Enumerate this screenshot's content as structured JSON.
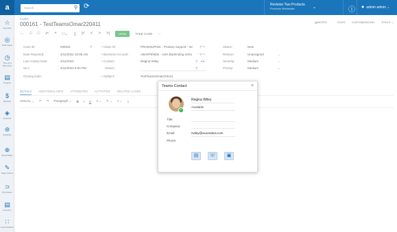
{
  "topbar": {
    "search_placeholder": "Search",
    "tenant_name": "Revision Two Products",
    "tenant_sub": "Products Wholesale",
    "user_name": "admin admin"
  },
  "sidebar": {
    "items": [
      {
        "label": "Favorites",
        "icon": "star-icon"
      },
      {
        "label": "Data Views",
        "icon": "views-icon"
      },
      {
        "label": "Time and Expenses",
        "icon": "clock-icon"
      },
      {
        "label": "Projects",
        "icon": "projects-icon"
      },
      {
        "label": "Banking",
        "icon": "dollar-icon"
      },
      {
        "label": "Products",
        "icon": "products-icon"
      },
      {
        "label": "Payables",
        "icon": "payables-icon"
      },
      {
        "label": "Receivables",
        "icon": "receivables-icon"
      },
      {
        "label": "Sales Orders",
        "icon": "sales-icon"
      },
      {
        "label": "Purchases",
        "icon": "cart-icon"
      },
      {
        "label": "Inventory",
        "icon": "truck-icon"
      },
      {
        "label": "Customization",
        "icon": "custom-icon"
      }
    ]
  },
  "page": {
    "breadcrumb": "Cases",
    "title": "000161 - TestTeamsOmar220411",
    "status_button": "OPEN",
    "take_case": "TAKE CASE",
    "more": "···",
    "right_tools": {
      "notes": "NOTES",
      "files": "FILES",
      "customization": "CUSTOMIZATION",
      "tools": "TOOLS"
    }
  },
  "form": {
    "case_id_label": "Case ID:",
    "case_id": "000161",
    "date_reported_label": "Date Reported:",
    "date_reported": "4/11/2022 10:06 AM",
    "last_activity_label": "Last Activity Date:",
    "last_activity": "4/11/2022",
    "sla_label": "SLA:",
    "sla": "4/11/2022 5:04 PM",
    "closing_label": "Closing Date:",
    "class_id_label": "• Class ID:",
    "class_id": "PRODSUPINC - Product Support - Inc",
    "business_label": "• Business Account:",
    "business": "ABARTENDE - USA Bartending Scho",
    "contact_label": "• Contact:",
    "contact": "Regina Wiley",
    "owner_label": "Owner:",
    "subject_label": "• Subject:",
    "subject": "TestTeamsOmar220411",
    "status_label": "Status:",
    "status": "New",
    "reason_label": "Reason:",
    "reason": "Unassigned",
    "severity_label": "Severity:",
    "severity": "Medium",
    "priority_label": "Priority:",
    "priority": "Medium"
  },
  "tabs": [
    "DETAILS",
    "ADDITIONAL INFO",
    "ATTRIBUTES",
    "ACTIVITIES",
    "RELATED CASES"
  ],
  "editor": {
    "visual": "VISUAL",
    "paragraph": "Paragraph"
  },
  "popup": {
    "title": "Teams Contact",
    "name": "Regina Wiley",
    "availability": "Available",
    "title_label": "Title:",
    "company_label": "Company:",
    "email_label": "Email:",
    "email": "rwiley@acumatica.com",
    "phone_label": "Phone:"
  },
  "colors": {
    "brand": "#1b75bb",
    "open": "#2faa4a",
    "available": "#37b34a"
  }
}
